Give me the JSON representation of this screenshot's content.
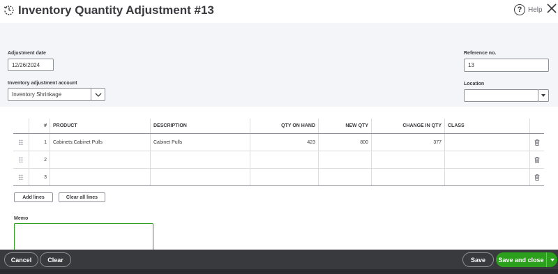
{
  "header": {
    "title": "Inventory Quantity Adjustment #13",
    "help_label": "Help",
    "help_glyph": "?"
  },
  "form": {
    "adjustment_date_label": "Adjustment date",
    "adjustment_date_value": "12/26/2024",
    "account_label": "Inventory adjustment account",
    "account_value": "Inventory Shrinkage",
    "reference_label": "Reference no.",
    "reference_value": "13",
    "location_label": "Location",
    "location_value": ""
  },
  "table": {
    "columns": [
      "#",
      "PRODUCT",
      "DESCRIPTION",
      "QTY ON HAND",
      "NEW QTY",
      "CHANGE IN QTY",
      "CLASS"
    ],
    "rows": [
      {
        "num": "1",
        "product": "Cabinets:Cabinet Pulls",
        "description": "Cabinet Pulls",
        "qty_on_hand": "423",
        "new_qty": "800",
        "change_in_qty": "377",
        "class": ""
      },
      {
        "num": "2",
        "product": "",
        "description": "",
        "qty_on_hand": "",
        "new_qty": "",
        "change_in_qty": "",
        "class": ""
      },
      {
        "num": "3",
        "product": "",
        "description": "",
        "qty_on_hand": "",
        "new_qty": "",
        "change_in_qty": "",
        "class": ""
      }
    ],
    "add_lines_label": "Add lines",
    "clear_all_lines_label": "Clear all lines"
  },
  "memo": {
    "label": "Memo",
    "value": ""
  },
  "footer": {
    "cancel_label": "Cancel",
    "clear_label": "Clear",
    "save_label": "Save",
    "save_and_close_label": "Save and close"
  },
  "colors": {
    "accent_green": "#2ca01c",
    "footer_bg": "#393a3d",
    "panel_bg": "#f4f5f8"
  },
  "icons": [
    "history-icon",
    "help-icon",
    "close-icon",
    "chevron-down-icon",
    "caret-down-icon",
    "drag-handle-icon",
    "trash-icon"
  ]
}
